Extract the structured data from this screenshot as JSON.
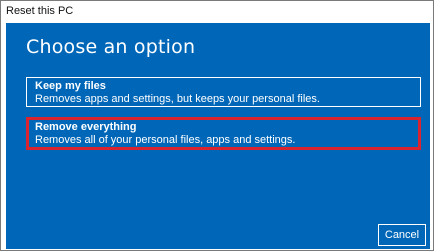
{
  "window": {
    "title": "Reset this PC"
  },
  "main": {
    "heading": "Choose an option",
    "options": [
      {
        "title": "Keep my files",
        "description": "Removes apps and settings, but keeps your personal files."
      },
      {
        "title": "Remove everything",
        "description": "Removes all of your personal files, apps and settings."
      }
    ],
    "cancel_label": "Cancel"
  },
  "colors": {
    "background": "#0067b8",
    "text": "#ffffff",
    "highlight": "#d9232e"
  }
}
